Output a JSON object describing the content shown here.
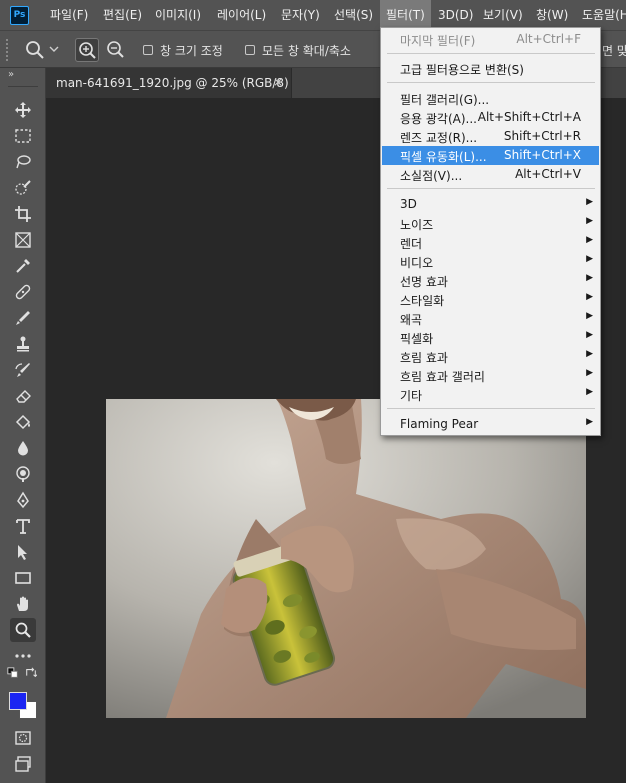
{
  "app": {
    "logo": "Ps"
  },
  "menubar": {
    "items": [
      "파일(F)",
      "편집(E)",
      "이미지(I)",
      "레이어(L)",
      "문자(Y)",
      "선택(S)",
      "필터(T)",
      "3D(D)",
      "보기(V)",
      "창(W)",
      "도움말(H)"
    ]
  },
  "options": {
    "resize_windows": "창 크기 조정",
    "zoom_all": "모든 창 확대/축소",
    "partial": "면 맞"
  },
  "document": {
    "tab_title": "man-641691_1920.jpg @ 25% (RGB/8)",
    "close": "×"
  },
  "filter_menu": {
    "last_filter": {
      "label": "마지막 필터(F)",
      "shortcut": "Alt+Ctrl+F"
    },
    "convert_smart": {
      "label": "고급 필터용으로 변환(S)"
    },
    "gallery": {
      "label": "필터 갤러리(G)..."
    },
    "wide_angle": {
      "label": "응용 광각(A)...",
      "shortcut": "Alt+Shift+Ctrl+A"
    },
    "lens": {
      "label": "렌즈 교정(R)...",
      "shortcut": "Shift+Ctrl+R"
    },
    "liquify": {
      "label": "픽셀 유동화(L)...",
      "shortcut": "Shift+Ctrl+X"
    },
    "vanishing": {
      "label": "소실점(V)...",
      "shortcut": "Alt+Ctrl+V"
    },
    "submenus": [
      "3D",
      "노이즈",
      "렌더",
      "비디오",
      "선명 효과",
      "스타일화",
      "왜곡",
      "픽셀화",
      "흐림 효과",
      "흐림 효과 갤러리",
      "기타"
    ],
    "plugin": "Flaming Pear"
  },
  "colors": {
    "foreground": "#1b25f2",
    "background": "#ffffff",
    "highlight": "#3b8ee5"
  }
}
